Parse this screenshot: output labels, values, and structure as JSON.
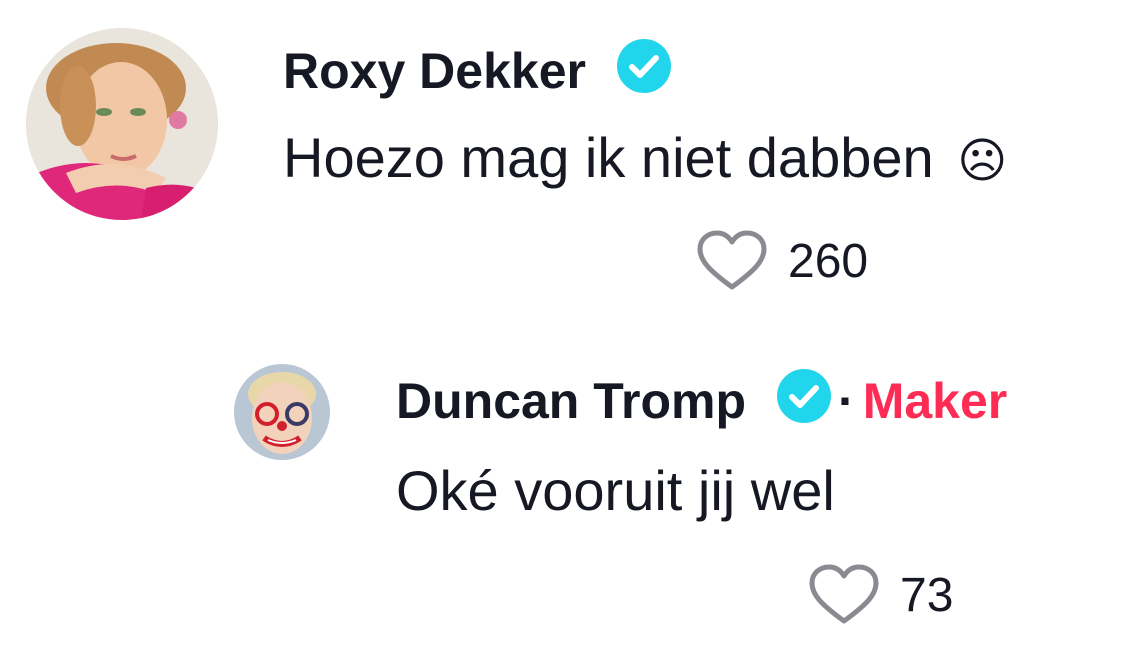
{
  "comments": [
    {
      "username": "Roxy Dekker",
      "verified": true,
      "text": "Hoezo mag ik niet dabben",
      "emoji": "☹",
      "likes": "260",
      "avatar_icon": "avatar-woman-portrait"
    },
    {
      "username": "Duncan Tromp",
      "verified": true,
      "separator": "·",
      "badge": "Maker",
      "text": "Oké vooruit jij wel",
      "likes": "73",
      "avatar_icon": "avatar-boy-face-paint"
    }
  ],
  "colors": {
    "verified": "#20D5EC",
    "maker": "#FE2C55",
    "text": "#161823",
    "like_icon": "#8A8B91"
  }
}
